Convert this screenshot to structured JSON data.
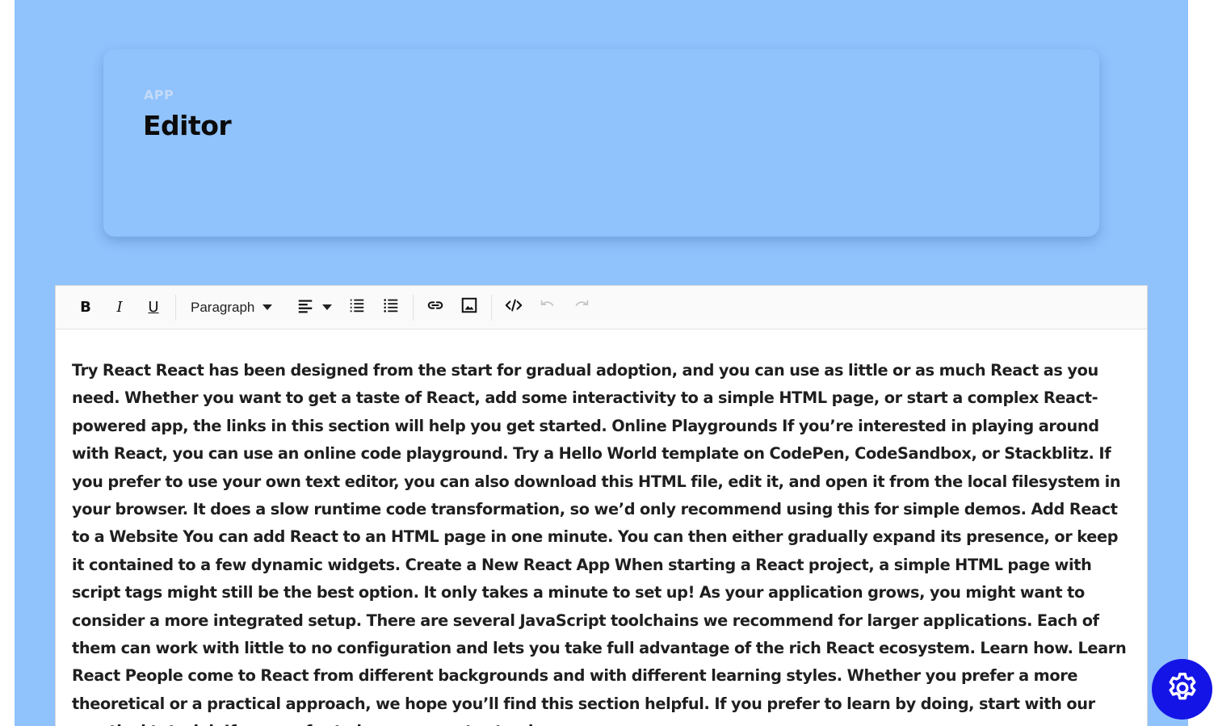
{
  "header": {
    "eyebrow": "APP",
    "title": "Editor"
  },
  "toolbar": {
    "bold": "B",
    "italic": "I",
    "underline": "U",
    "block_type": "Paragraph",
    "icons": [
      "bold-icon",
      "italic-icon",
      "underline-icon",
      "align-left-icon",
      "ordered-list-icon",
      "bullet-list-icon",
      "link-icon",
      "image-icon",
      "code-icon",
      "undo-icon",
      "redo-icon"
    ]
  },
  "editor": {
    "content": "Try React React has been designed from the start for gradual adoption, and you can use as little or as much React as you need. Whether you want to get a taste of React, add some interactivity to a simple HTML page, or start a complex React-powered app, the links in this section will help you get started. Online Playgrounds If you’re interested in playing around with React, you can use an online code playground. Try a Hello World template on CodePen, CodeSandbox, or Stackblitz. If you prefer to use your own text editor, you can also download this HTML file, edit it, and open it from the local filesystem in your browser. It does a slow runtime code transformation, so we’d only recommend using this for simple demos. Add React to a Website You can add React to an HTML page in one minute. You can then either gradually expand its presence, or keep it contained to a few dynamic widgets. Create a New React App When starting a React project, a simple HTML page with script tags might still be the best option. It only takes a minute to set up! As your application grows, you might want to consider a more integrated setup. There are several JavaScript toolchains we recommend for larger applications. Each of them can work with little to no configuration and lets you take full advantage of the rich React ecosystem. Learn how. Learn React People come to React from different backgrounds and with different learning styles. Whether you prefer a more theoretical or a practical approach, we hope you’ll find this section helpful. If you prefer to learn by doing, start with our practical tutorial. If you prefer to learn concepts step by"
  },
  "fab": {
    "icon": "gear-icon",
    "color": "#1414e6"
  },
  "colors": {
    "page_background": "#90c2fc",
    "toolbar_background": "#fafafa"
  }
}
